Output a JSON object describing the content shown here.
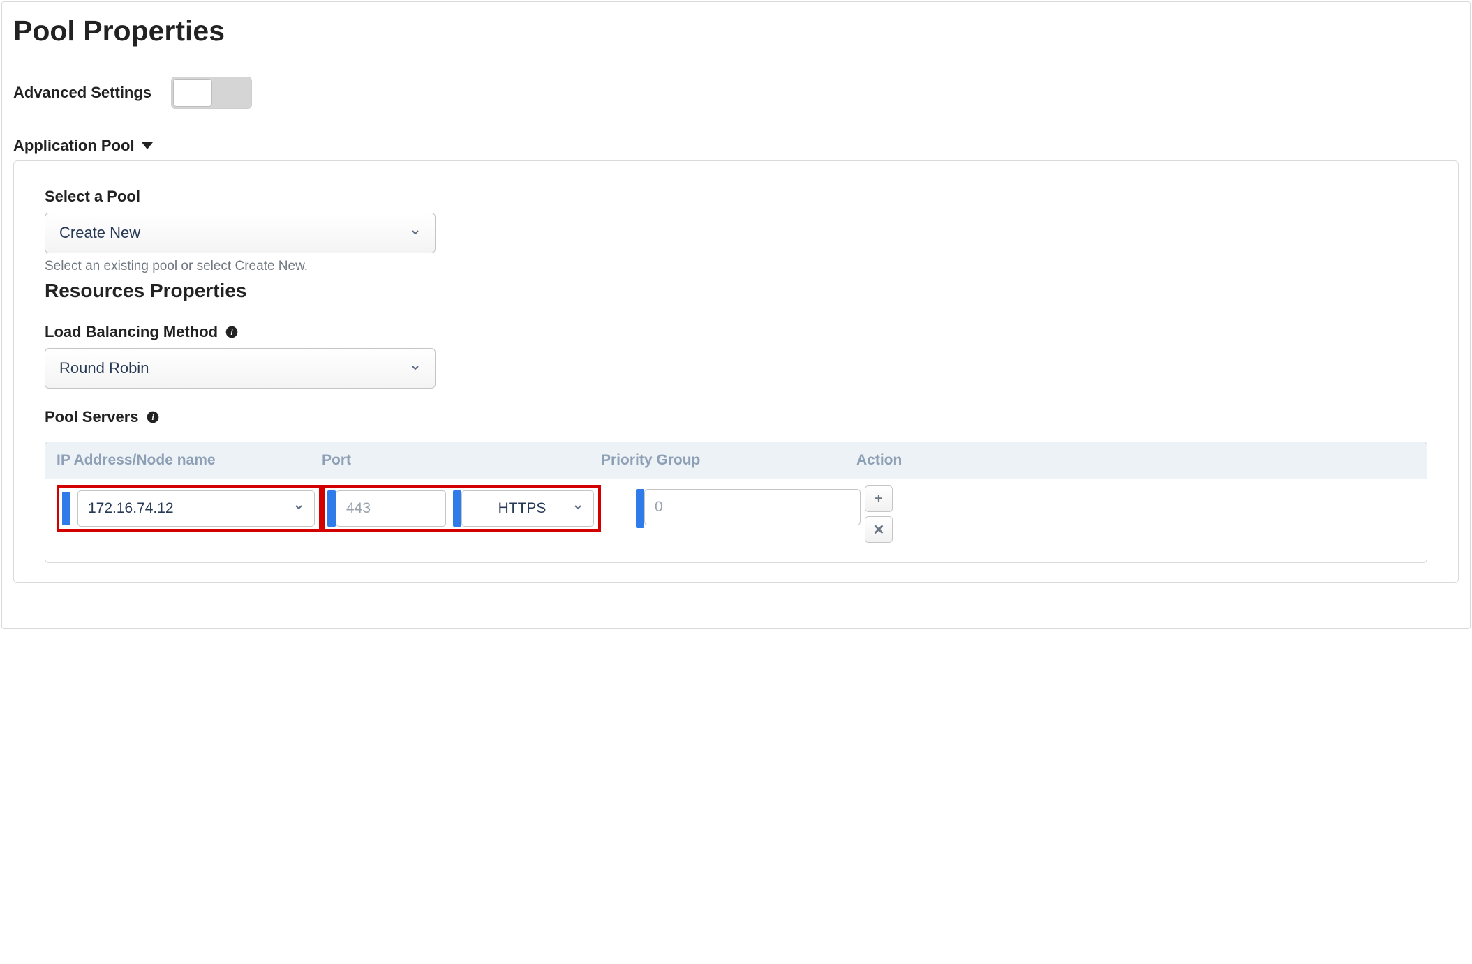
{
  "page": {
    "title": "Pool Properties",
    "advanced_label": "Advanced Settings",
    "section_heading": "Application Pool"
  },
  "pool_select": {
    "label": "Select a Pool",
    "value": "Create New",
    "helper": "Select an existing pool or select Create New."
  },
  "resources_heading": "Resources Properties",
  "lb_method": {
    "label": "Load Balancing Method",
    "value": "Round Robin"
  },
  "pool_servers": {
    "label": "Pool Servers",
    "columns": {
      "ip": "IP Address/Node name",
      "port": "Port",
      "pg": "Priority Group",
      "action": "Action"
    },
    "rows": [
      {
        "ip": "172.16.74.12",
        "port": "443",
        "protocol": "HTTPS",
        "priority_group": "0"
      }
    ]
  }
}
